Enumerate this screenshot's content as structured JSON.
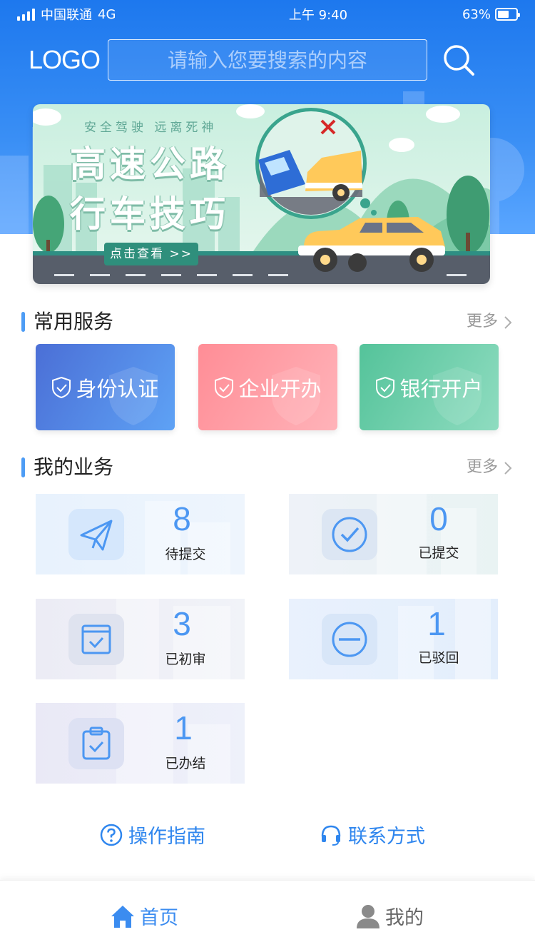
{
  "status_bar": {
    "carrier": "中国联通",
    "network": "4G",
    "time": "上午 9:40",
    "battery": "63%",
    "battery_level": 0.63
  },
  "header": {
    "logo": "LOGO",
    "search_placeholder": "请输入您要搜索的内容",
    "search_icon": "search-icon"
  },
  "banner": {
    "subtitle": "安全驾驶  远离死神",
    "title_line1": "高速公路",
    "title_line2": "行车技巧",
    "button_label": "点击查看 >>"
  },
  "common_services": {
    "title": "常用服务",
    "more_label": "更多",
    "items": [
      {
        "label": "身份认证",
        "icon": "shield-check-icon"
      },
      {
        "label": "企业开办",
        "icon": "shield-check-icon"
      },
      {
        "label": "银行开户",
        "icon": "shield-check-icon"
      }
    ]
  },
  "my_business": {
    "title": "我的业务",
    "more_label": "更多",
    "items": [
      {
        "count": "8",
        "label": "待提交",
        "icon": "paper-plane-icon"
      },
      {
        "count": "0",
        "label": "已提交",
        "icon": "check-circle-icon"
      },
      {
        "count": "3",
        "label": "已初审",
        "icon": "checkbox-icon"
      },
      {
        "count": "1",
        "label": "已驳回",
        "icon": "minus-circle-icon"
      },
      {
        "count": "1",
        "label": "已办结",
        "icon": "clipboard-check-icon"
      }
    ]
  },
  "links": {
    "guide": "操作指南",
    "contact": "联系方式"
  },
  "tabbar": {
    "home": "首页",
    "mine": "我的"
  },
  "colors": {
    "primary": "#2f86ee",
    "header_blue": "#1d78ee",
    "service_blue": "#5ea2f5",
    "service_pink": "#ff8d96",
    "service_green": "#54c39a"
  }
}
